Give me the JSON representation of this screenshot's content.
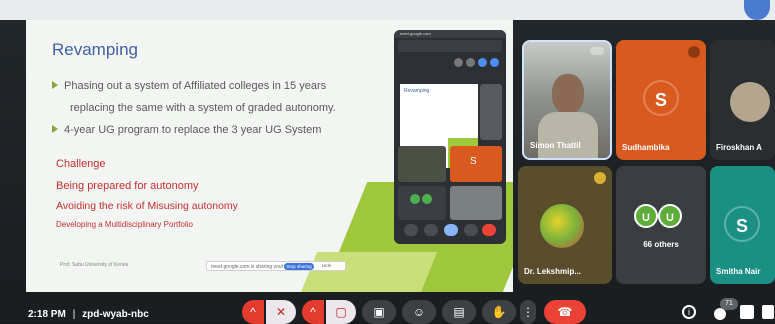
{
  "slide": {
    "title": "Revamping",
    "bullets": [
      "Phasing out a system of Affiliated colleges in 15 years",
      "replacing the same with a system of graded autonomy.",
      "4-year UG program to replace the 3  year UG System"
    ],
    "red_lines": [
      "Challenge",
      "Being prepared for autonomy",
      "Avoiding the risk of Misusing autonomy",
      "Developing a Multidisciplinary Portfolio"
    ],
    "footer": "Prof. Sabu University of Kerala",
    "share_notice": "meet.google.com is sharing your screen.",
    "stop_label": "Stop sharing",
    "hide_label": "Hide"
  },
  "inset": {
    "url": "meet.google.com",
    "title": "Revamping"
  },
  "participants": [
    {
      "name": "Simon Thattil",
      "type": "video"
    },
    {
      "name": "Sudhambika",
      "initial": "S",
      "color": "#d9591e"
    },
    {
      "name": "Firoskhan A",
      "type": "photo"
    },
    {
      "name": "Dr. Lekshmip...",
      "type": "photo"
    },
    {
      "name": "66 others",
      "initials": [
        "U",
        "U"
      ]
    },
    {
      "name": "Smitha Nair",
      "initial": "S",
      "color": "#1a8f83"
    }
  ],
  "meeting": {
    "time": "2:18 PM",
    "separator": "|",
    "code": "zpd-wyab-nbc",
    "participant_count": "71"
  },
  "colors": {
    "end_call": "#ea4335",
    "control": "#3c4043",
    "control_off": "#e8ebee"
  }
}
